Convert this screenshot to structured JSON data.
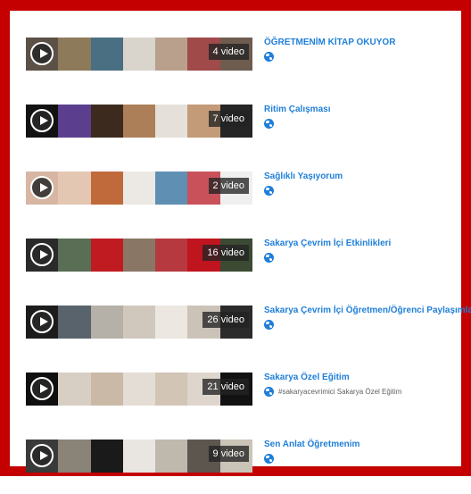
{
  "playlists": [
    {
      "title": "ÖĞRETMENİM KİTAP OKUYOR",
      "count": "4 video",
      "description": "",
      "frames": [
        "#5c5146",
        "#8c7a5a",
        "#4a6f82",
        "#d9d4cc",
        "#b8a08d",
        "#a04a4a",
        "#6e5c4f"
      ]
    },
    {
      "title": "Ritim Çalışması",
      "count": "7 video",
      "description": "",
      "frames": [
        "#121212",
        "#5b3f8e",
        "#3d2a1f",
        "#ad7f59",
        "#e5e1da",
        "#c39b78",
        "#252525"
      ]
    },
    {
      "title": "Sağlıklı Yaşıyorum",
      "count": "2 video",
      "description": "",
      "frames": [
        "#d7b6a4",
        "#e3c7b3",
        "#c06a3c",
        "#ece9e4",
        "#5f8fb3",
        "#c9525a",
        "#efefef"
      ]
    },
    {
      "title": "Sakarya Çevrim İçi Etkinlikleri",
      "count": "16 video",
      "description": "",
      "frames": [
        "#2a2a2a",
        "#5a6d55",
        "#c11b22",
        "#8a7665",
        "#b63940",
        "#c0141f",
        "#3c4a34"
      ]
    },
    {
      "title": "Sakarya Çevrim İçi Öğretmen/Öğrenci Paylaşımları",
      "count": "26 video",
      "description": "",
      "frames": [
        "#1c1c1c",
        "#58636b",
        "#b5b0a8",
        "#d1c8bd",
        "#ece7e0",
        "#cbc3b8",
        "#2b2b2b"
      ]
    },
    {
      "title": "Sakarya Özel Eğitim",
      "count": "21 video",
      "description": "#sakaryacevrimici Sakarya Özel Eğitim",
      "frames": [
        "#0f0f0f",
        "#d8cfc4",
        "#c9b9a6",
        "#e3ddd6",
        "#d2c5b5",
        "#ded6cc",
        "#121212"
      ]
    },
    {
      "title": "Sen Anlat Öğretmenim",
      "count": "9 video",
      "description": "",
      "frames": [
        "#3a3a3a",
        "#8a8378",
        "#1a1a1a",
        "#e9e6e1",
        "#bfb8ad",
        "#5d564f",
        "#cac3b8"
      ]
    }
  ]
}
